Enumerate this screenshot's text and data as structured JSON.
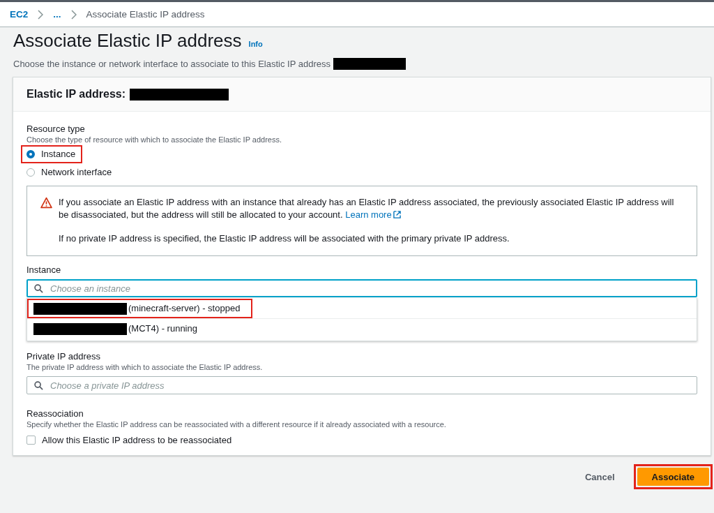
{
  "breadcrumbs": [
    {
      "label": "EC2",
      "link": true
    },
    {
      "label": "...",
      "link": true
    },
    {
      "label": "Associate Elastic IP address",
      "link": false
    }
  ],
  "page": {
    "title": "Associate Elastic IP address",
    "info": "Info",
    "description": "Choose the instance or network interface to associate to this Elastic IP address",
    "description_redacted": true
  },
  "card": {
    "header": "Elastic IP address:",
    "header_redacted": true
  },
  "resource_type": {
    "label": "Resource type",
    "description": "Choose the type of resource with which to associate the Elastic IP address.",
    "options": [
      {
        "label": "Instance",
        "selected": true,
        "highlighted": true
      },
      {
        "label": "Network interface",
        "selected": false,
        "highlighted": false
      }
    ]
  },
  "alert": {
    "text": "If you associate an Elastic IP address with an instance that already has an Elastic IP address associated, the previously associated Elastic IP address will be disassociated, but the address will still be allocated to your account.",
    "link": "Learn more",
    "note": "If no private IP address is specified, the Elastic IP address will be associated with the primary private IP address."
  },
  "instance": {
    "label": "Instance",
    "placeholder": "Choose an instance",
    "focused": true,
    "options": [
      {
        "label": "(minecraft-server) - stopped",
        "redacted": true,
        "highlighted": true
      },
      {
        "label": "(MCT4) - running",
        "redacted": true,
        "highlighted": false
      }
    ]
  },
  "private_ip": {
    "label": "Private IP address",
    "description": "The private IP address with which to associate the Elastic IP address.",
    "placeholder": "Choose a private IP address"
  },
  "reassociation": {
    "label": "Reassociation",
    "description": "Specify whether the Elastic IP address can be reassociated with a different resource if it already associated with a resource.",
    "checkbox": {
      "label": "Allow this Elastic IP address to be reassociated",
      "checked": false
    }
  },
  "buttons": [
    {
      "label": "Cancel",
      "kind": "link",
      "highlighted": false
    },
    {
      "label": "Associate",
      "kind": "primary",
      "highlighted": true
    }
  ]
}
